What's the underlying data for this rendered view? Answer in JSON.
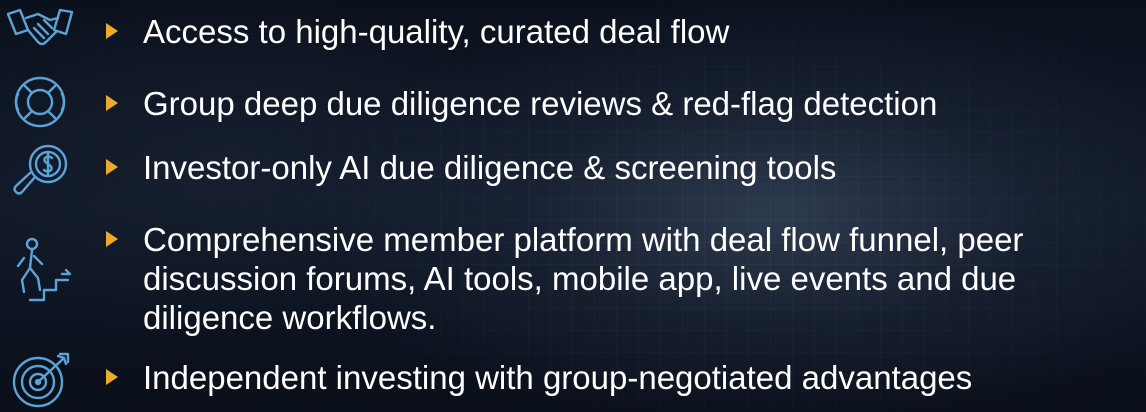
{
  "colors": {
    "bullet": "#e9ab2c",
    "icon": "#5aa3d8",
    "text": "#ffffff"
  },
  "items": [
    {
      "icon": "handshake-icon",
      "text": "Access to high-quality, curated deal flow"
    },
    {
      "icon": "lifebuoy-icon",
      "text": "Group deep due diligence reviews & red-flag detection"
    },
    {
      "icon": "magnifier-dollar-icon",
      "text": "Investor-only AI due diligence & screening tools"
    },
    {
      "icon": "person-climbing-stairs-icon",
      "text": "Comprehensive member platform with deal flow funnel, peer discussion forums, AI tools, mobile app, live events and due diligence workflows."
    },
    {
      "icon": "target-arrow-icon",
      "text": "Independent investing with group-negotiated advantages"
    }
  ]
}
